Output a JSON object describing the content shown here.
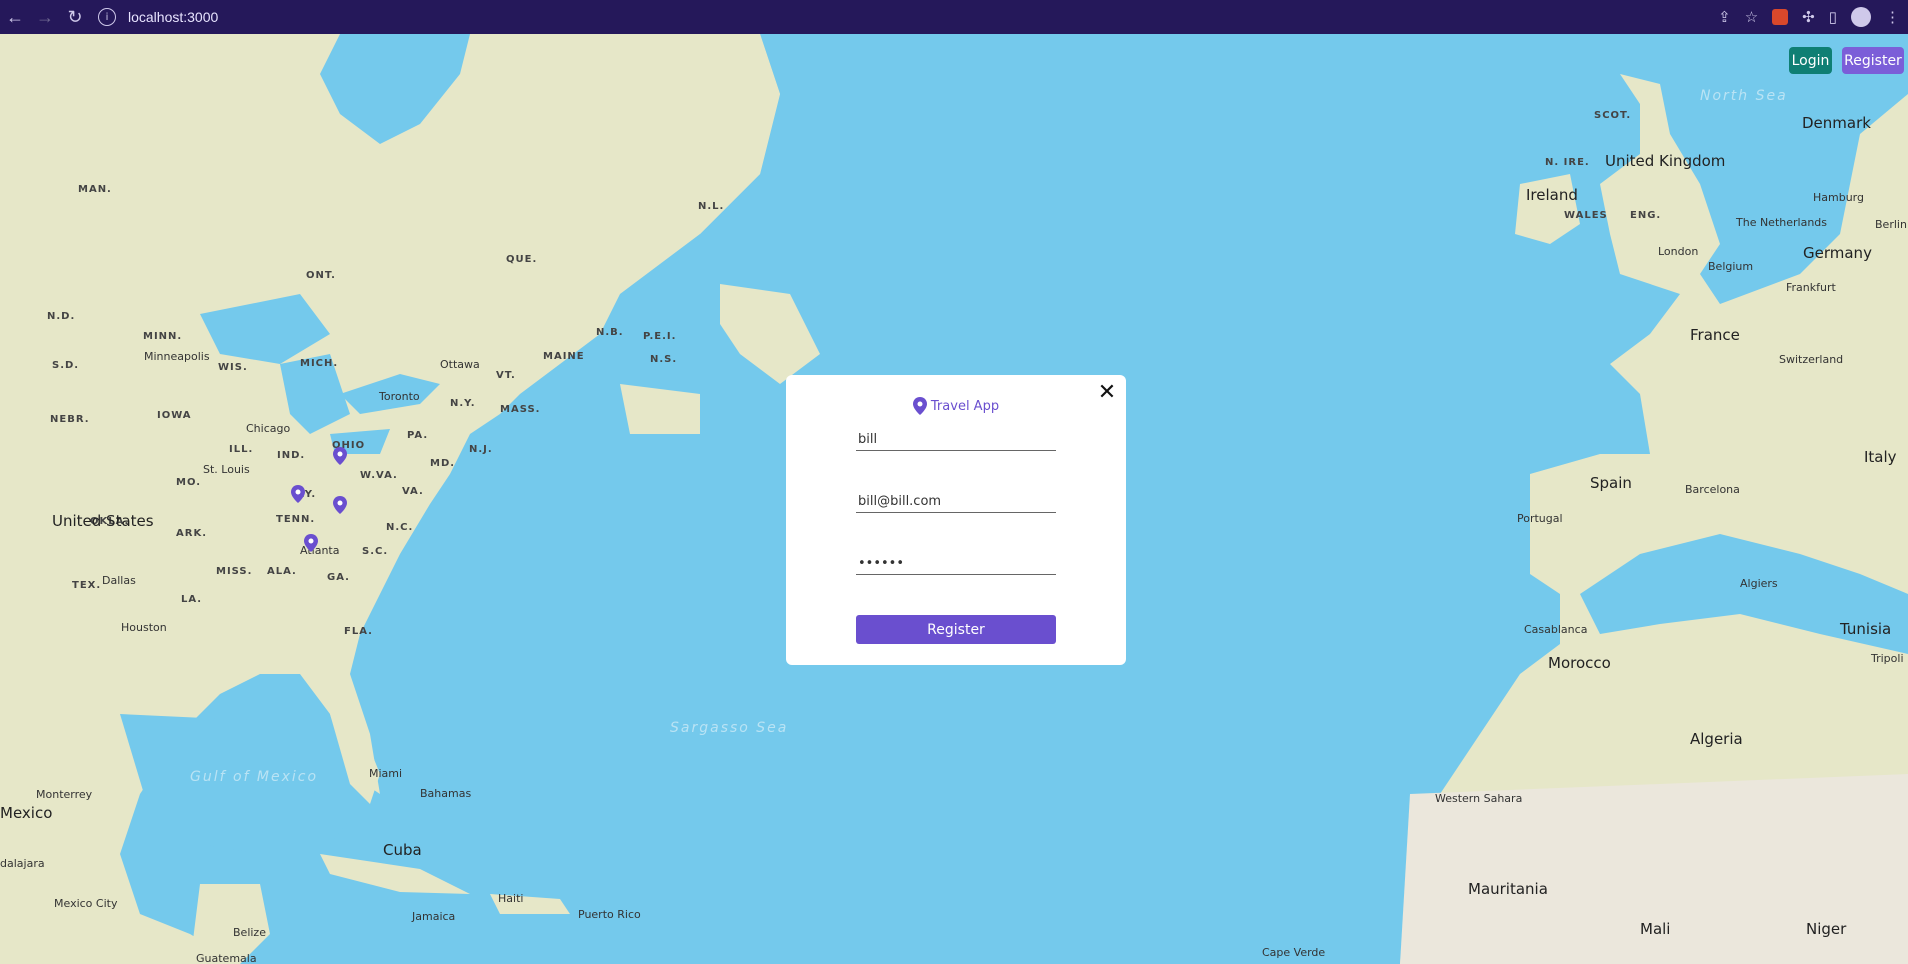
{
  "browser": {
    "url": "localhost:3000"
  },
  "header": {
    "login_label": "Login",
    "register_label": "Register"
  },
  "modal": {
    "app_name": "Travel App",
    "username_value": "bill",
    "email_value": "bill@bill.com",
    "password_value": "••••••",
    "submit_label": "Register"
  },
  "map": {
    "states": [
      "MAN.",
      "ONT.",
      "QUE.",
      "N.L.",
      "N.D.",
      "MINN.",
      "S.D.",
      "WIS.",
      "MICH.",
      "NEBR.",
      "IOWA",
      "ILL.",
      "IND.",
      "OHIO",
      "PA.",
      "N.Y.",
      "VT.",
      "MAINE",
      "N.B.",
      "P.E.I.",
      "N.S.",
      "MASS.",
      "N.J.",
      "MD.",
      "W.VA.",
      "VA.",
      "KY.",
      "MO.",
      "TENN.",
      "N.C.",
      "S.C.",
      "OKLA.",
      "ARK.",
      "MISS.",
      "ALA.",
      "GA.",
      "TEX.",
      "LA.",
      "FLA.",
      "SCOT.",
      "N. IRE.",
      "WALES",
      "ENG."
    ],
    "cities": [
      "Minneapolis",
      "Ottawa",
      "Toronto",
      "Chicago",
      "St. Louis",
      "Atlanta",
      "Dallas",
      "Houston",
      "Miami",
      "Bahamas",
      "Monterrey",
      "Mexico City",
      "Jamaica",
      "Haiti",
      "Puerto Rico",
      "Belize",
      "Guatemala",
      "Hamburg",
      "Berlin",
      "The Netherlands",
      "Belgium",
      "London",
      "Frankfurt",
      "Switzerland",
      "Portugal",
      "Barcelona",
      "Algiers",
      "Casablanca",
      "Tripoli",
      "Cape Verde",
      "Western Sahara",
      "dalajara"
    ],
    "countries": [
      "United States",
      "Mexico",
      "Cuba",
      "Ireland",
      "United Kingdom",
      "Denmark",
      "Germany",
      "France",
      "Spain",
      "Italy",
      "Tunisia",
      "Morocco",
      "Algeria",
      "Mauritania",
      "Mali",
      "Niger"
    ],
    "seas": [
      "North Sea",
      "Gulf of Mexico",
      "Sargasso Sea"
    ]
  },
  "colors": {
    "browser_bar": "#25185a",
    "ocean": "#74c9ec",
    "land": "#e6e7c8",
    "accent": "#6a4fcf",
    "login": "#0f7f74"
  }
}
